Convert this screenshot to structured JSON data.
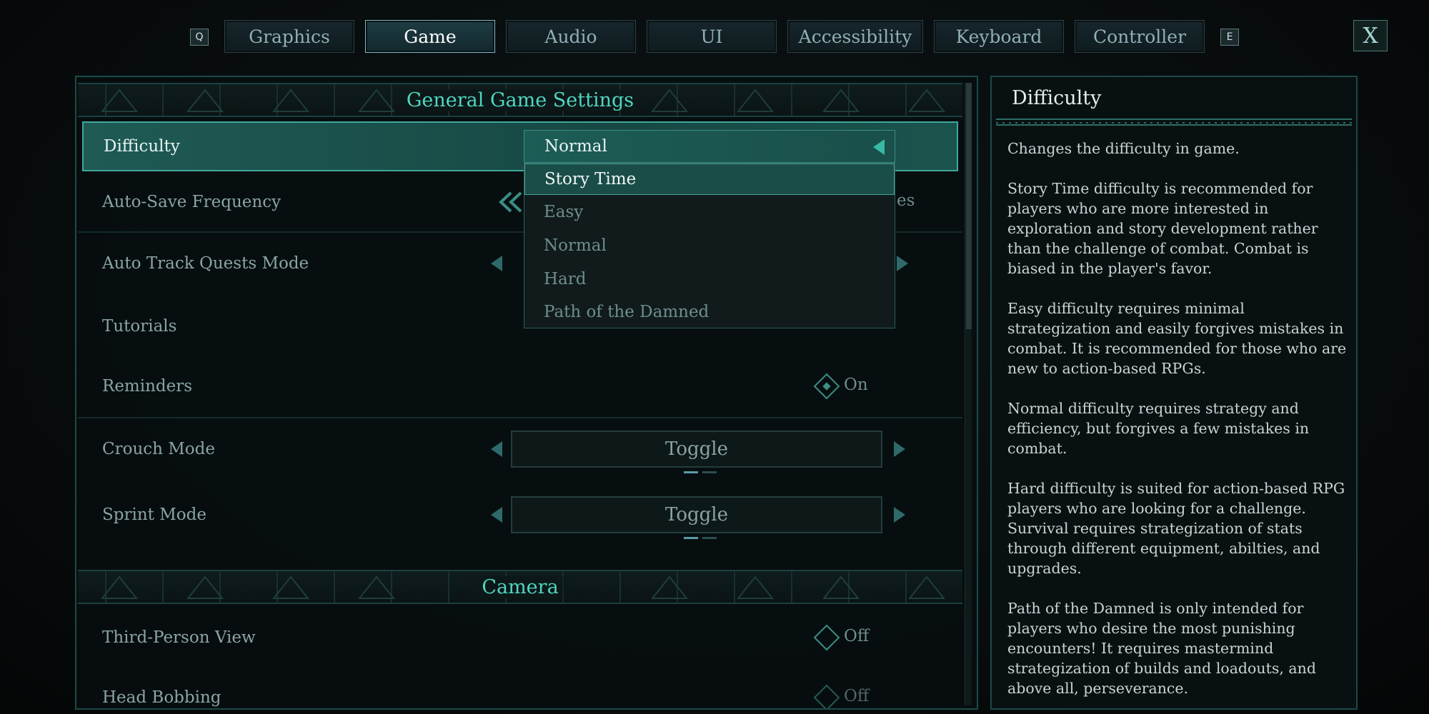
{
  "tabs": {
    "prev_key": "Q",
    "next_key": "E",
    "items": [
      "Graphics",
      "Game",
      "Audio",
      "UI",
      "Accessibility",
      "Keyboard",
      "Controller"
    ],
    "active": "Game",
    "close_label": "X"
  },
  "general": {
    "title": "General Game Settings",
    "difficulty": {
      "label": "Difficulty",
      "value": "Normal"
    },
    "autosave": {
      "label": "Auto-Save Frequency",
      "value_fragment": "es"
    },
    "auto_track": {
      "label": "Auto Track Quests Mode"
    },
    "tutorials": {
      "label": "Tutorials"
    },
    "reminders": {
      "label": "Reminders",
      "value": "On"
    },
    "crouch": {
      "label": "Crouch Mode",
      "value": "Toggle"
    },
    "sprint": {
      "label": "Sprint Mode",
      "value": "Toggle"
    }
  },
  "camera": {
    "title": "Camera",
    "third_person": {
      "label": "Third-Person View",
      "value": "Off"
    },
    "head_bobbing": {
      "label": "Head Bobbing",
      "value": "Off"
    }
  },
  "dropdown": {
    "current": "Normal",
    "options": [
      "Story Time",
      "Easy",
      "Normal",
      "Hard",
      "Path of the Damned"
    ],
    "highlighted": "Story Time"
  },
  "info": {
    "title": "Difficulty",
    "paragraphs": [
      "Changes the difficulty in game.",
      "Story Time difficulty is recommended for players who are more interested in exploration and story development rather than the challenge of combat. Combat is biased in the player's favor.",
      "Easy difficulty requires minimal strategization and easily forgives mistakes in combat. It is recommended for those who are new to action-based RPGs.",
      "Normal difficulty requires strategy and efficiency, but forgives a few mistakes in combat.",
      "Hard difficulty is suited for action-based RPG players who are looking for a challenge. Survival requires strategization of stats through different equipment, abilties, and upgrades.",
      "Path of the Damned is only intended for players who desire the most punishing encounters! It requires mastermind strategization of builds and loadouts, and above all, perseverance."
    ]
  },
  "colors": {
    "accent": "#4fd6bf",
    "selected_row": "#1f5a55",
    "panel_border": "#1c4a48"
  }
}
